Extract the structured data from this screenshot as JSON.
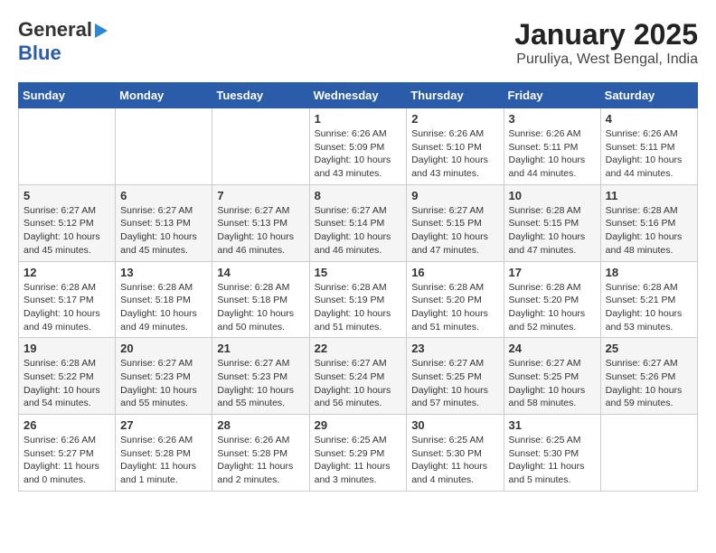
{
  "header": {
    "logo_line1": "General",
    "logo_line2": "Blue",
    "title": "January 2025",
    "subtitle": "Puruliya, West Bengal, India"
  },
  "weekdays": [
    "Sunday",
    "Monday",
    "Tuesday",
    "Wednesday",
    "Thursday",
    "Friday",
    "Saturday"
  ],
  "weeks": [
    [
      {
        "day": "",
        "info": ""
      },
      {
        "day": "",
        "info": ""
      },
      {
        "day": "",
        "info": ""
      },
      {
        "day": "1",
        "info": "Sunrise: 6:26 AM\nSunset: 5:09 PM\nDaylight: 10 hours\nand 43 minutes."
      },
      {
        "day": "2",
        "info": "Sunrise: 6:26 AM\nSunset: 5:10 PM\nDaylight: 10 hours\nand 43 minutes."
      },
      {
        "day": "3",
        "info": "Sunrise: 6:26 AM\nSunset: 5:11 PM\nDaylight: 10 hours\nand 44 minutes."
      },
      {
        "day": "4",
        "info": "Sunrise: 6:26 AM\nSunset: 5:11 PM\nDaylight: 10 hours\nand 44 minutes."
      }
    ],
    [
      {
        "day": "5",
        "info": "Sunrise: 6:27 AM\nSunset: 5:12 PM\nDaylight: 10 hours\nand 45 minutes."
      },
      {
        "day": "6",
        "info": "Sunrise: 6:27 AM\nSunset: 5:13 PM\nDaylight: 10 hours\nand 45 minutes."
      },
      {
        "day": "7",
        "info": "Sunrise: 6:27 AM\nSunset: 5:13 PM\nDaylight: 10 hours\nand 46 minutes."
      },
      {
        "day": "8",
        "info": "Sunrise: 6:27 AM\nSunset: 5:14 PM\nDaylight: 10 hours\nand 46 minutes."
      },
      {
        "day": "9",
        "info": "Sunrise: 6:27 AM\nSunset: 5:15 PM\nDaylight: 10 hours\nand 47 minutes."
      },
      {
        "day": "10",
        "info": "Sunrise: 6:28 AM\nSunset: 5:15 PM\nDaylight: 10 hours\nand 47 minutes."
      },
      {
        "day": "11",
        "info": "Sunrise: 6:28 AM\nSunset: 5:16 PM\nDaylight: 10 hours\nand 48 minutes."
      }
    ],
    [
      {
        "day": "12",
        "info": "Sunrise: 6:28 AM\nSunset: 5:17 PM\nDaylight: 10 hours\nand 49 minutes."
      },
      {
        "day": "13",
        "info": "Sunrise: 6:28 AM\nSunset: 5:18 PM\nDaylight: 10 hours\nand 49 minutes."
      },
      {
        "day": "14",
        "info": "Sunrise: 6:28 AM\nSunset: 5:18 PM\nDaylight: 10 hours\nand 50 minutes."
      },
      {
        "day": "15",
        "info": "Sunrise: 6:28 AM\nSunset: 5:19 PM\nDaylight: 10 hours\nand 51 minutes."
      },
      {
        "day": "16",
        "info": "Sunrise: 6:28 AM\nSunset: 5:20 PM\nDaylight: 10 hours\nand 51 minutes."
      },
      {
        "day": "17",
        "info": "Sunrise: 6:28 AM\nSunset: 5:20 PM\nDaylight: 10 hours\nand 52 minutes."
      },
      {
        "day": "18",
        "info": "Sunrise: 6:28 AM\nSunset: 5:21 PM\nDaylight: 10 hours\nand 53 minutes."
      }
    ],
    [
      {
        "day": "19",
        "info": "Sunrise: 6:28 AM\nSunset: 5:22 PM\nDaylight: 10 hours\nand 54 minutes."
      },
      {
        "day": "20",
        "info": "Sunrise: 6:27 AM\nSunset: 5:23 PM\nDaylight: 10 hours\nand 55 minutes."
      },
      {
        "day": "21",
        "info": "Sunrise: 6:27 AM\nSunset: 5:23 PM\nDaylight: 10 hours\nand 55 minutes."
      },
      {
        "day": "22",
        "info": "Sunrise: 6:27 AM\nSunset: 5:24 PM\nDaylight: 10 hours\nand 56 minutes."
      },
      {
        "day": "23",
        "info": "Sunrise: 6:27 AM\nSunset: 5:25 PM\nDaylight: 10 hours\nand 57 minutes."
      },
      {
        "day": "24",
        "info": "Sunrise: 6:27 AM\nSunset: 5:25 PM\nDaylight: 10 hours\nand 58 minutes."
      },
      {
        "day": "25",
        "info": "Sunrise: 6:27 AM\nSunset: 5:26 PM\nDaylight: 10 hours\nand 59 minutes."
      }
    ],
    [
      {
        "day": "26",
        "info": "Sunrise: 6:26 AM\nSunset: 5:27 PM\nDaylight: 11 hours\nand 0 minutes."
      },
      {
        "day": "27",
        "info": "Sunrise: 6:26 AM\nSunset: 5:28 PM\nDaylight: 11 hours\nand 1 minute."
      },
      {
        "day": "28",
        "info": "Sunrise: 6:26 AM\nSunset: 5:28 PM\nDaylight: 11 hours\nand 2 minutes."
      },
      {
        "day": "29",
        "info": "Sunrise: 6:25 AM\nSunset: 5:29 PM\nDaylight: 11 hours\nand 3 minutes."
      },
      {
        "day": "30",
        "info": "Sunrise: 6:25 AM\nSunset: 5:30 PM\nDaylight: 11 hours\nand 4 minutes."
      },
      {
        "day": "31",
        "info": "Sunrise: 6:25 AM\nSunset: 5:30 PM\nDaylight: 11 hours\nand 5 minutes."
      },
      {
        "day": "",
        "info": ""
      }
    ]
  ]
}
